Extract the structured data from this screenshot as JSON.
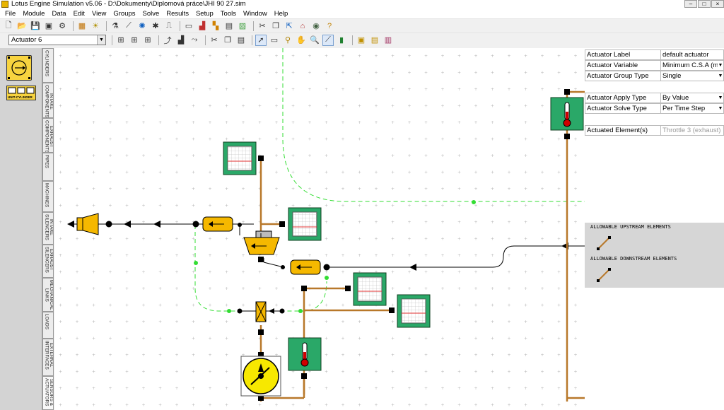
{
  "window": {
    "title": "Lotus Engine Simulation v5.06 - D:\\Dokumenty\\Diplomová práce\\JHI 90 27.sim"
  },
  "menu": [
    "File",
    "Module",
    "Data",
    "Edit",
    "View",
    "Groups",
    "Solve",
    "Results",
    "Setup",
    "Tools",
    "Window",
    "Help"
  ],
  "toolbar": {
    "actuator_select": "Actuator 6"
  },
  "palette": {
    "unit_cylinder_label": "UNIT-CYLINDER"
  },
  "tabs": [
    "CYLINDERS",
    "INTAKE\nCOMPONENTS",
    "EXHAUST\nCOMPONENTS",
    "PIPES",
    "MACHINES",
    "INTAKE\nSILENCERS",
    "EXHAUST\nSILENCERS",
    "MECHANICAL\nLINKS",
    "LOADS",
    "EXTERNAL\nINTERFACES",
    "SENSORS &\nACTUATORS"
  ],
  "properties": [
    {
      "label": "Actuator Label",
      "value": "default actuator",
      "dropdown": false
    },
    {
      "label": "Actuator Variable",
      "value": "Minimum C.S.A (mm)",
      "dropdown": true
    },
    {
      "label": "Actuator Group Type",
      "value": "Single",
      "dropdown": true
    },
    {
      "label": "Actuator Apply Type",
      "value": "By Value",
      "dropdown": true
    },
    {
      "label": "Actuator Solve Type",
      "value": "Per Time Step",
      "dropdown": true
    },
    {
      "label": "Actuated Element(s)",
      "value": "Throttle 3 (exhaust)",
      "dropdown": false,
      "disabled": true
    }
  ],
  "allowable": {
    "upstream": "ALLOWABLE UPSTREAM ELEMENTS",
    "downstream": "ALLOWABLE DOWNSTREAM ELEMENTS"
  },
  "colors": {
    "pipe": "#b8782a",
    "green_link": "#33dd33",
    "component": "#f5b800",
    "sensor_bg": "#2aa868"
  }
}
